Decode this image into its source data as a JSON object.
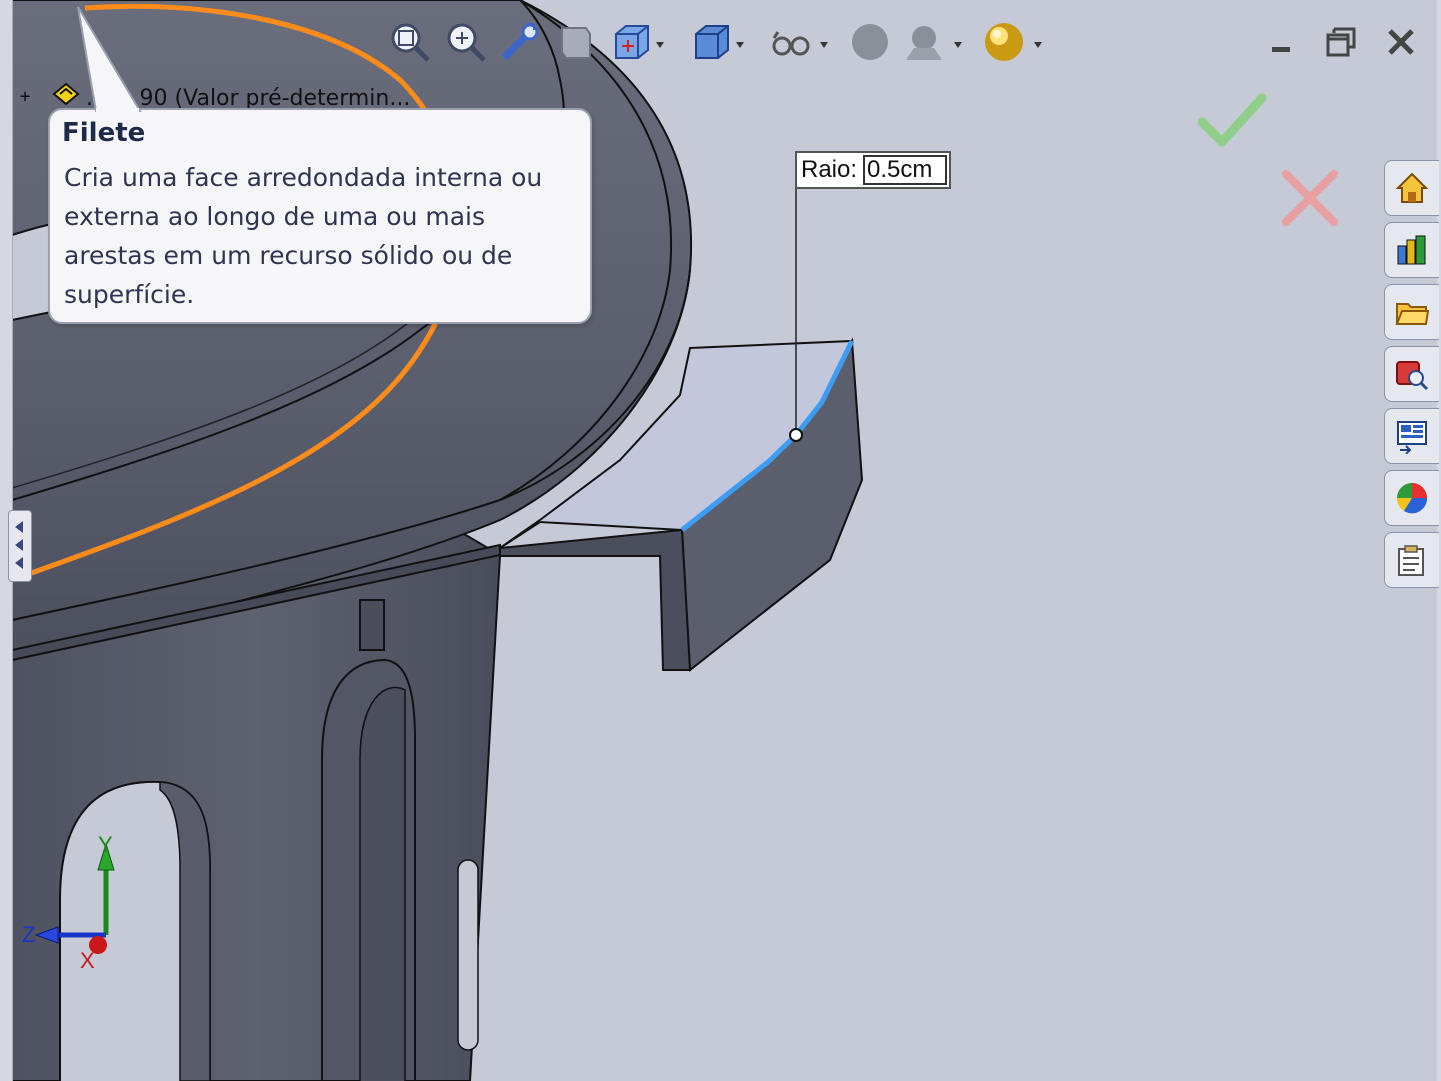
{
  "tree": {
    "expander": "+",
    "item_text": "...ca 90 (Valor pré-determin..."
  },
  "tooltip": {
    "title": "Filete",
    "body": "Cria uma face arredondada interna ou externa ao longo de uma ou mais arestas em um recurso sólido ou de superfície."
  },
  "dimension": {
    "label": "Raio:",
    "value": "0.5cm"
  },
  "triad": {
    "x": "X",
    "y": "Y",
    "z": "Z"
  },
  "toolbar": {
    "items": [
      "zoom-to-fit-icon",
      "zoom-to-area-icon",
      "previous-view-icon",
      "section-view-icon",
      "view-orientation-icon",
      "display-style-icon",
      "hide-show-items-icon",
      "edit-appearance-icon",
      "apply-scene-icon",
      "view-settings-icon"
    ]
  },
  "task_pane": {
    "tabs": [
      "solidworks-resources-icon",
      "design-library-icon",
      "file-explorer-icon",
      "search-icon",
      "view-palette-icon",
      "appearances-scenes-icon",
      "custom-properties-icon"
    ]
  },
  "colors": {
    "background": "#c6cad6",
    "model": "#5b5f6e",
    "highlight_orange": "#ff8c1a",
    "selected_edge": "#3d9df5",
    "ok_green": "#8fcf8a",
    "cancel_red": "#e8a0a0"
  }
}
